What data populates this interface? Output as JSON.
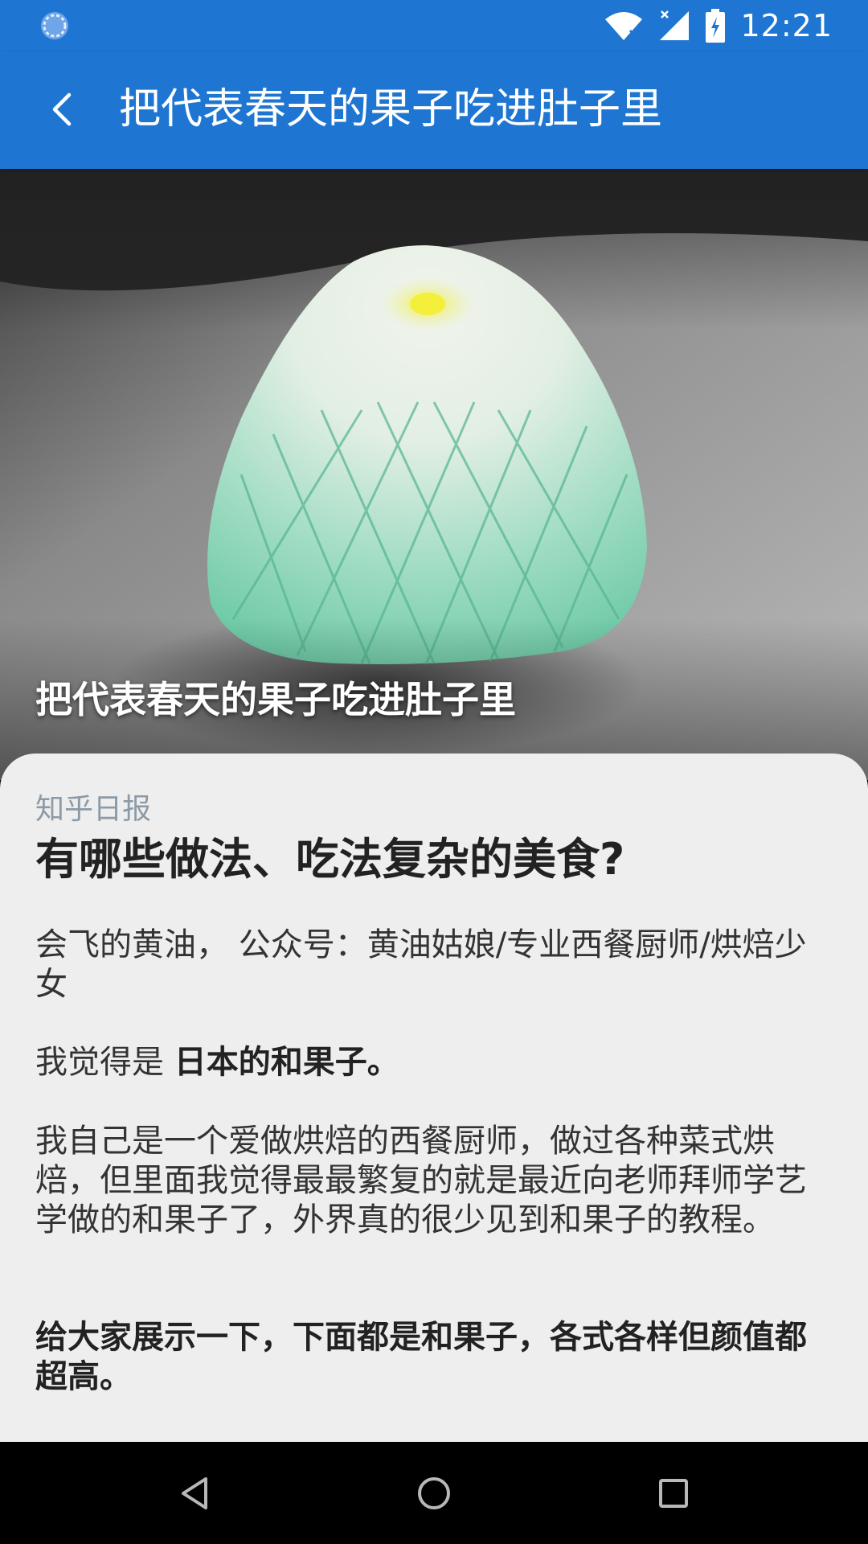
{
  "status_bar": {
    "time": "12:21",
    "icons": [
      "loading-icon",
      "wifi-icon",
      "signal-icon",
      "battery-charging-icon"
    ]
  },
  "app_bar": {
    "title": "把代表春天的果子吃进肚子里",
    "back_icon": "chevron-left-icon"
  },
  "hero": {
    "caption": "把代表春天的果子吃进肚子里"
  },
  "article": {
    "source": "知乎日报",
    "question": "有哪些做法、吃法复杂的美食?",
    "author_line": "会飞的黄油， 公众号：黄油姑娘/专业西餐厨师/烘焙少女",
    "think_prefix": "我觉得是 ",
    "think_bold": "日本的和果子。",
    "description": "我自己是一个爱做烘焙的西餐厨师，做过各种菜式烘焙，但里面我觉得最最繁复的就是最近向老师拜师学艺学做的和果子了，外界真的很少见到和果子的教程。",
    "showcase": "给大家展示一下，下面都是和果子，各式各样但颜值都超高。"
  },
  "nav_bar": {
    "icons": [
      "back-triangle-icon",
      "home-circle-icon",
      "recents-square-icon"
    ]
  },
  "colors": {
    "primary": "#1E76D2",
    "card_bg": "#EEEEEE",
    "source_text": "#8C9AA6"
  }
}
